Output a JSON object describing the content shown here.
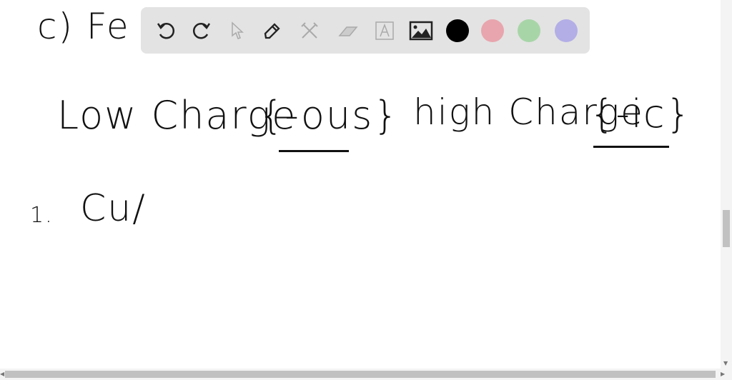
{
  "canvas": {
    "line_c": "c) Fe",
    "low_charge": "Low Charge",
    "low_suffix": "{-ous}",
    "high_charge": "high Charge",
    "high_suffix": "{-ic}",
    "item_1_num": "1.",
    "item_1_text": "Cu/"
  },
  "toolbar": {
    "tools": [
      "undo-icon",
      "redo-icon",
      "select-icon",
      "pen-icon",
      "tools-icon",
      "eraser-icon",
      "text-icon",
      "image-icon"
    ],
    "colors": [
      "#000000",
      "#e8a5ad",
      "#a8d5a8",
      "#b3aee6"
    ]
  }
}
